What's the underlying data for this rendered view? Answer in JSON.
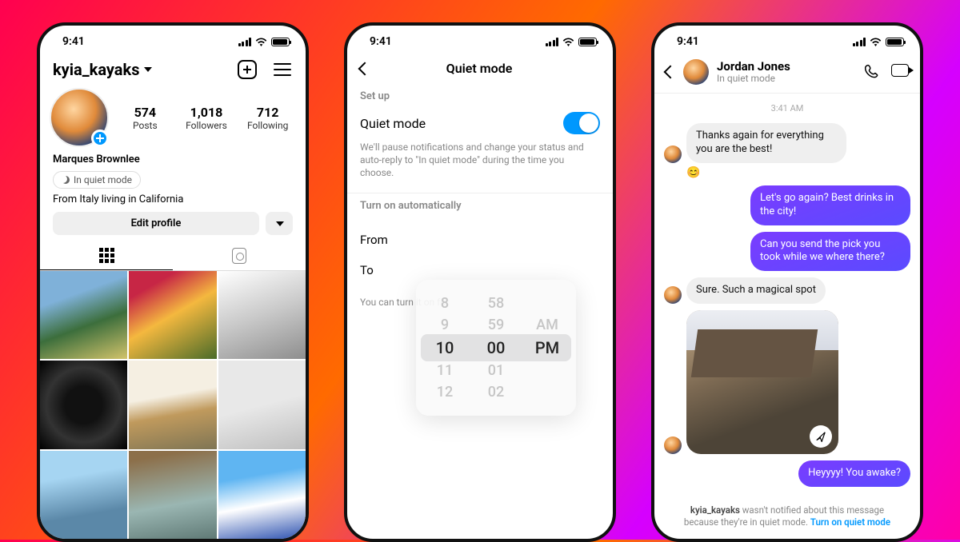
{
  "status": {
    "time": "9:41"
  },
  "profile": {
    "username": "kyia_kayaks",
    "stats": {
      "posts_n": "574",
      "posts_l": "Posts",
      "followers_n": "1,018",
      "followers_l": "Followers",
      "following_n": "712",
      "following_l": "Following"
    },
    "display_name": "Marques Brownlee",
    "quiet_chip": "In quiet mode",
    "bio": "From Italy living in California",
    "edit_btn": "Edit profile"
  },
  "settings": {
    "title": "Quiet mode",
    "section_setup": "Set up",
    "row_label": "Quiet mode",
    "description": "We'll pause notifications and change your status and auto-reply to \"In quiet mode\" during the time you choose.",
    "section_auto": "Turn on automatically",
    "from_label": "From",
    "to_label": "To",
    "hint": "You can turn it on for",
    "picker": {
      "h_m2": "8",
      "h_m1": "9",
      "h_sel": "10",
      "h_p1": "11",
      "h_p2": "12",
      "m_m2": "58",
      "m_m1": "59",
      "m_sel": "00",
      "m_p1": "01",
      "m_p2": "02",
      "ap_m1": "AM",
      "ap_sel": "PM"
    }
  },
  "dm": {
    "contact": "Jordan Jones",
    "substatus": "In quiet mode",
    "timestamp": "3:41 AM",
    "msg1": "Thanks again for everything you are the best!",
    "react1": "😊",
    "msg2": "Let's go again? Best drinks in the city!",
    "msg3": "Can you send the pick you took while we where there?",
    "msg4": "Sure. Such a magical spot",
    "msg5": "Heyyyy! You awake?",
    "notice_name": "kyia_kayaks",
    "notice_rest": " wasn't notified about this message because they're in quiet mode. ",
    "notice_link": "Turn on quiet mode"
  }
}
